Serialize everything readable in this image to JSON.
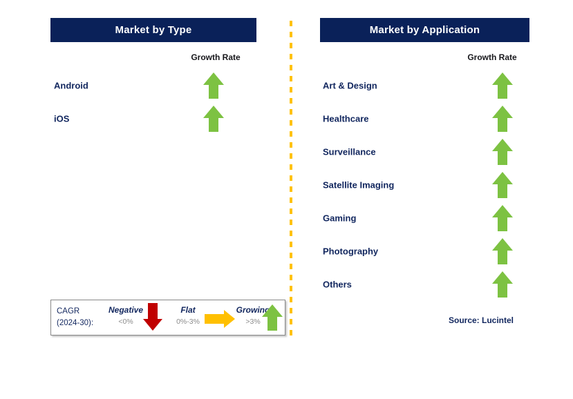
{
  "colors": {
    "header_bg": "#0A2159",
    "header_text": "#FFFFFF",
    "label_navy": "#11265E",
    "growth_green": "#7DC242",
    "negative_red": "#C00000",
    "flat_orange": "#FFC000",
    "divider_yellow": "#FFC20E",
    "legend_range_gray": "#8A8A8A"
  },
  "left_panel": {
    "header": "Market by Type",
    "column_header": "Growth Rate",
    "rows": [
      {
        "label": "Android",
        "trend": "growing",
        "icon": "arrow-up-icon"
      },
      {
        "label": "iOS",
        "trend": "growing",
        "icon": "arrow-up-icon"
      }
    ]
  },
  "right_panel": {
    "header": "Market by Application",
    "column_header": "Growth Rate",
    "rows": [
      {
        "label": "Art & Design",
        "trend": "growing",
        "icon": "arrow-up-icon"
      },
      {
        "label": "Healthcare",
        "trend": "growing",
        "icon": "arrow-up-icon"
      },
      {
        "label": "Surveillance",
        "trend": "growing",
        "icon": "arrow-up-icon"
      },
      {
        "label": "Satellite Imaging",
        "trend": "growing",
        "icon": "arrow-up-icon"
      },
      {
        "label": "Gaming",
        "trend": "growing",
        "icon": "arrow-up-icon"
      },
      {
        "label": "Photography",
        "trend": "growing",
        "icon": "arrow-up-icon"
      },
      {
        "label": "Others",
        "trend": "growing",
        "icon": "arrow-up-icon"
      }
    ]
  },
  "legend": {
    "title_line1": "CAGR",
    "title_line2": "(2024-30):",
    "items": [
      {
        "name": "Negative",
        "range": "<0%",
        "icon": "arrow-down-icon",
        "color": "#C00000"
      },
      {
        "name": "Flat",
        "range": "0%-3%",
        "icon": "arrow-right-icon",
        "color": "#FFC000"
      },
      {
        "name": "Growing",
        "range": ">3%",
        "icon": "arrow-up-icon",
        "color": "#7DC242"
      }
    ]
  },
  "source": "Source: Lucintel"
}
